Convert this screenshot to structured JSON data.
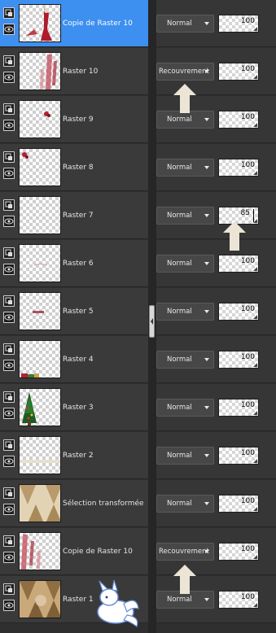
{
  "layers": [
    {
      "name": "Copie de Raster 10",
      "blend": "Normal",
      "opacity": "100",
      "selected": true,
      "thumb": "woman-red"
    },
    {
      "name": "Raster 10",
      "blend": "Recouvrement",
      "opacity": "100",
      "selected": false,
      "thumb": "red-streaks"
    },
    {
      "name": "Raster 9",
      "blend": "Normal",
      "opacity": "100",
      "selected": false,
      "thumb": "small-ornament"
    },
    {
      "name": "Raster 8",
      "blend": "Normal",
      "opacity": "100",
      "selected": false,
      "thumb": "corner-ornament"
    },
    {
      "name": "Raster 7",
      "blend": "Normal",
      "opacity": "85",
      "selected": false,
      "thumb": "empty"
    },
    {
      "name": "Raster 6",
      "blend": "Normal",
      "opacity": "100",
      "selected": false,
      "thumb": "faint-text"
    },
    {
      "name": "Raster 5",
      "blend": "Normal",
      "opacity": "100",
      "selected": false,
      "thumb": "small-text"
    },
    {
      "name": "Raster 4",
      "blend": "Normal",
      "opacity": "100",
      "selected": false,
      "thumb": "gift-bottom"
    },
    {
      "name": "Raster 3",
      "blend": "Normal",
      "opacity": "100",
      "selected": false,
      "thumb": "christmas-tree"
    },
    {
      "name": "Raster 2",
      "blend": "Normal",
      "opacity": "100",
      "selected": false,
      "thumb": "faint-band"
    },
    {
      "name": "Sélection transformée",
      "blend": "Normal",
      "opacity": "100",
      "selected": false,
      "thumb": "beige-pattern"
    },
    {
      "name": "Copie de Raster 10",
      "blend": "Recouvrement",
      "opacity": "100",
      "selected": false,
      "thumb": "red-streaks"
    },
    {
      "name": "Raster 1",
      "blend": "Normal",
      "opacity": "100",
      "selected": false,
      "thumb": "beige-pattern-dark"
    }
  ],
  "colors": {
    "selected": "#3d8ff0",
    "panel": "#3a3a3a",
    "arrow": "#ece4d4"
  },
  "icons": {
    "layer_type": "layer-raster-icon",
    "visibility": "eye-icon",
    "arrow": "up-arrow-icon"
  }
}
